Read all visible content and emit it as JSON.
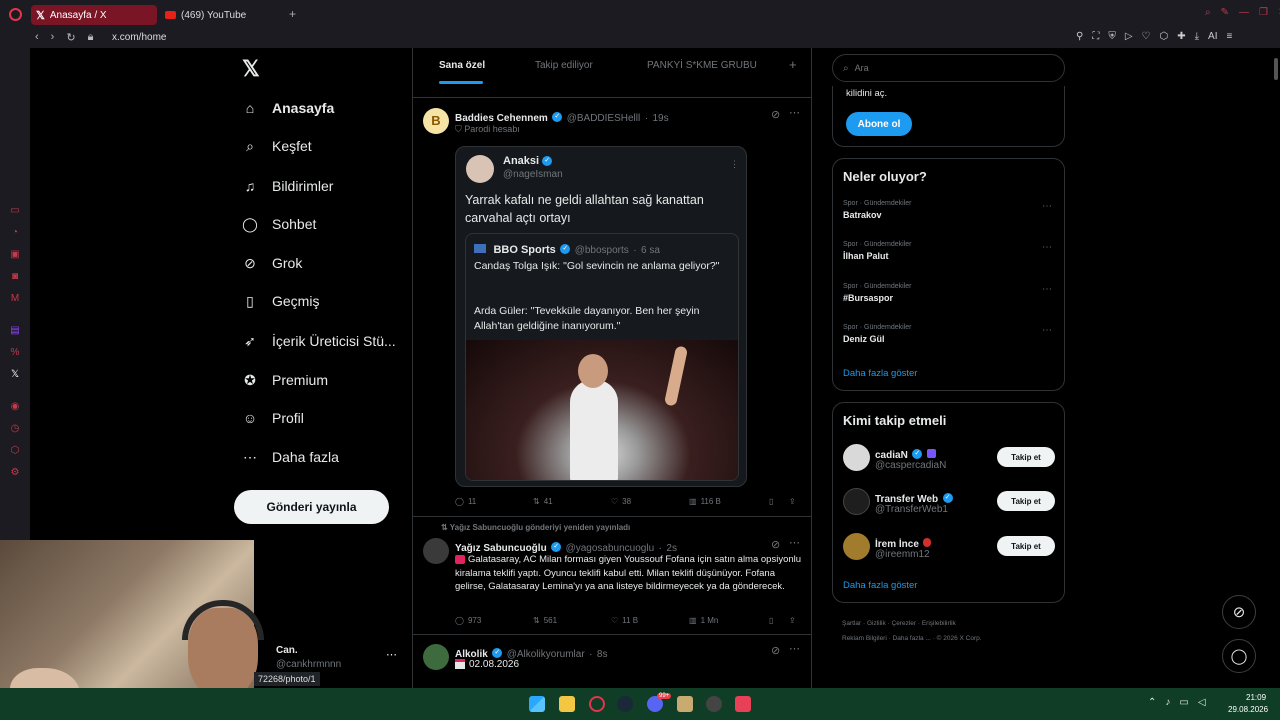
{
  "browser": {
    "tabs": [
      {
        "label": "Anasayfa / X",
        "active": true
      },
      {
        "label": "(469) YouTube",
        "active": false
      }
    ],
    "url": "x.com/home",
    "toolbar_ai_label": "AI"
  },
  "nav": {
    "items": [
      {
        "label": "Anasayfa",
        "icon": "home-icon"
      },
      {
        "label": "Keşfet",
        "icon": "search-icon"
      },
      {
        "label": "Bildirimler",
        "icon": "bell-icon"
      },
      {
        "label": "Sohbet",
        "icon": "chat-icon"
      },
      {
        "label": "Grok",
        "icon": "grok-icon"
      },
      {
        "label": "Geçmiş",
        "icon": "bookmark-icon"
      },
      {
        "label": "İçerik Üreticisi Stü...",
        "icon": "rocket-icon"
      },
      {
        "label": "Premium",
        "icon": "premium-icon"
      },
      {
        "label": "Profil",
        "icon": "person-icon"
      },
      {
        "label": "Daha fazla",
        "icon": "more-circle-icon"
      }
    ],
    "post_button": "Gönderi yayınla",
    "account": {
      "name": "Can.",
      "handle": "@cankhrmnnn",
      "status_url": "72268/photo/1"
    }
  },
  "feed": {
    "tabs": [
      "Sana özel",
      "Takip ediliyor",
      "PANKYİ S*KME GRUBU"
    ],
    "add_tab": "+",
    "tweets": [
      {
        "author": "Baddies Cehennem",
        "handle": "@BADDIESHelll",
        "time": "19s",
        "badge": "Parodi hesabı",
        "quote": {
          "author": "Anaksi",
          "handle": "@nageIsman",
          "text": "Yarrak kafalı ne geldi allahtan sağ kanattan carvahal açtı ortayı",
          "inner": {
            "author": "BBO Sports",
            "handle": "@bbosports",
            "time": "6 sa",
            "text1": "Candaş Tolga Işık: \"Gol sevincin ne anlama geliyor?\"",
            "text2": "Arda Güler: \"Tevekküle dayanıyor. Ben her şeyin Allah'tan geldiğine inanıyorum.\""
          }
        },
        "stats": {
          "replies": "11",
          "reposts": "41",
          "likes": "38",
          "views": "116 B"
        }
      },
      {
        "repost_note": "Yağız Sabuncuoğlu gönderiyi yeniden yayınladı",
        "author": "Yağız Sabuncuoğlu",
        "handle": "@yagosabuncuoglu",
        "time": "2s",
        "text": "Galatasaray, AC Milan forması giyen Youssouf Fofana için satın alma opsiyonlu  kiralama teklifi yaptı. Oyuncu teklifi kabul etti. Milan teklifi düşünüyor. Fofana gelirse, Galatasaray Lemina'yı ya ana listeye bildirmeyecek ya da gönderecek.",
        "stats": {
          "replies": "973",
          "reposts": "561",
          "likes": "11 B",
          "views": "1 Mn"
        }
      },
      {
        "author": "Alkolik",
        "handle": "@Alkolikyorumlar",
        "time": "8s",
        "text": "02.08.2026"
      }
    ]
  },
  "right": {
    "search_placeholder": "Ara",
    "premium_text": "kilidini aç.",
    "subscribe_button": "Abone ol",
    "trends_title": "Neler oluyor?",
    "trends": [
      {
        "category": "Spor · Gündemdekiler",
        "name": "Batrakov"
      },
      {
        "category": "Spor · Gündemdekiler",
        "name": "İlhan Palut"
      },
      {
        "category": "Spor · Gündemdekiler",
        "name": "#Bursaspor"
      },
      {
        "category": "Spor · Gündemdekiler",
        "name": "Deniz Gül"
      }
    ],
    "show_more": "Daha fazla göster",
    "follow_title": "Kimi takip etmeli",
    "follow": [
      {
        "name": "cadiaN",
        "handle": "@caspercadiaN"
      },
      {
        "name": "Transfer Web",
        "handle": "@TransferWeb1"
      },
      {
        "name": "İrem İnce",
        "handle": "@ireemm12"
      }
    ],
    "follow_button": "Takip et",
    "footer": [
      "Şartlar",
      "Gizlilik",
      "Çerezler",
      "Erişilebilirlik",
      "Reklam Bilgileri",
      "Daha fazla ...",
      "© 2026 X Corp."
    ]
  },
  "taskbar": {
    "time": "21:09",
    "date": "29.08.2026",
    "notification_count": "99+"
  },
  "colors": {
    "accent": "#1d9bf0",
    "browser_tab": "#7a1526",
    "taskbar": "#0f3d26"
  }
}
